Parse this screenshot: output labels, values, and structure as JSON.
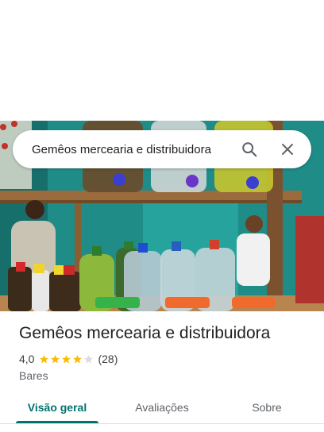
{
  "search": {
    "query": "Gemêos mercearia e distribuidora",
    "search_icon": "search-icon",
    "close_icon": "close-icon"
  },
  "photo": {
    "description_icon": "place-photo"
  },
  "place": {
    "title": "Gemêos mercearia e distribuidora",
    "rating": "4,0",
    "rating_value": 4.0,
    "rating_max": 5,
    "review_count": "(28)",
    "category": "Bares"
  },
  "tabs": [
    {
      "label": "Visão geral",
      "active": true
    },
    {
      "label": "Avaliações",
      "active": false
    },
    {
      "label": "Sobre",
      "active": false
    }
  ],
  "colors": {
    "accent": "#00736f",
    "star": "#fbbc04",
    "star_empty": "#dadce0"
  }
}
